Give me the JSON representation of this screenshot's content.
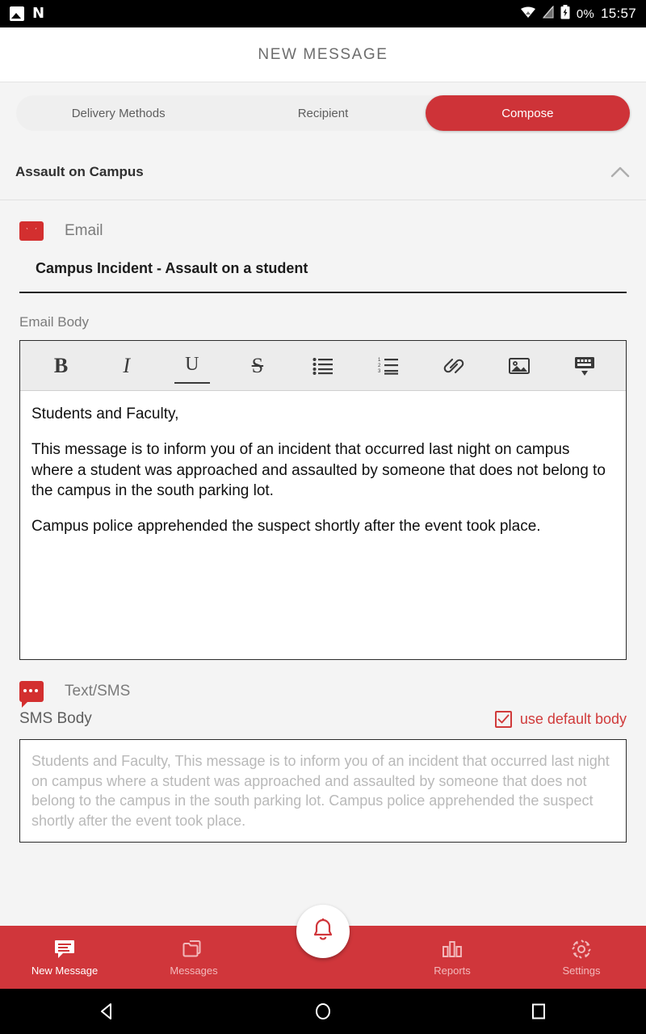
{
  "status_bar": {
    "icons": [
      "photo-icon",
      "netflix-n-icon",
      "wifi-icon",
      "signal-off-icon",
      "battery-charging-icon"
    ],
    "battery_percent": "0%",
    "time": "15:57"
  },
  "header": {
    "title": "NEW MESSAGE"
  },
  "tabs": [
    {
      "label": "Delivery Methods",
      "active": false
    },
    {
      "label": "Recipient",
      "active": false
    },
    {
      "label": "Compose",
      "active": true
    }
  ],
  "section": {
    "title": "Assault on Campus",
    "collapse_icon": "chevron-up-icon"
  },
  "email": {
    "channel_label": "Email",
    "channel_icon": "envelope-icon",
    "subject_value": "Campus Incident - Assault on a student",
    "body_label": "Email Body",
    "toolbar": [
      {
        "name": "bold-icon",
        "glyph": "B"
      },
      {
        "name": "italic-icon",
        "glyph": "I"
      },
      {
        "name": "underline-icon",
        "glyph": "U"
      },
      {
        "name": "strikethrough-icon",
        "glyph": "S"
      },
      {
        "name": "bullet-list-icon",
        "glyph": ""
      },
      {
        "name": "numbered-list-icon",
        "glyph": ""
      },
      {
        "name": "link-icon",
        "glyph": ""
      },
      {
        "name": "image-icon",
        "glyph": ""
      },
      {
        "name": "hide-keyboard-icon",
        "glyph": ""
      }
    ],
    "body_paragraphs": [
      "Students and Faculty,",
      " This message is to inform you of an incident that occurred last night on campus where a student was approached and assaulted by someone that does not belong to the campus in the south parking lot.",
      " Campus police apprehended the suspect shortly after the event took place."
    ]
  },
  "sms": {
    "channel_label": "Text/SMS",
    "channel_icon": "chat-bubble-icon",
    "body_label": "SMS Body",
    "use_default_label": "use default body",
    "use_default_checked": true,
    "placeholder": "Students and Faculty, This message is to inform you of an incident that occurred last night on campus where a student was approached and assaulted by someone that does not belong to the campus in the south parking lot. Campus police apprehended the suspect shortly after the event took place."
  },
  "bottom_nav": {
    "items": [
      {
        "label": "New Message",
        "icon": "message-icon",
        "active": true
      },
      {
        "label": "Messages",
        "icon": "folder-icon",
        "active": false
      },
      {
        "label": "Reports",
        "icon": "bar-chart-icon",
        "active": false
      },
      {
        "label": "Settings",
        "icon": "gear-icon",
        "active": false
      }
    ],
    "fab_icon": "bell-icon"
  },
  "android_nav": {
    "back": "back-triangle-icon",
    "home": "home-circle-icon",
    "recents": "recents-square-icon"
  },
  "colors": {
    "accent_red": "#ce3338",
    "nav_red": "#d0363b",
    "checkbox_red": "#d03a3a"
  }
}
